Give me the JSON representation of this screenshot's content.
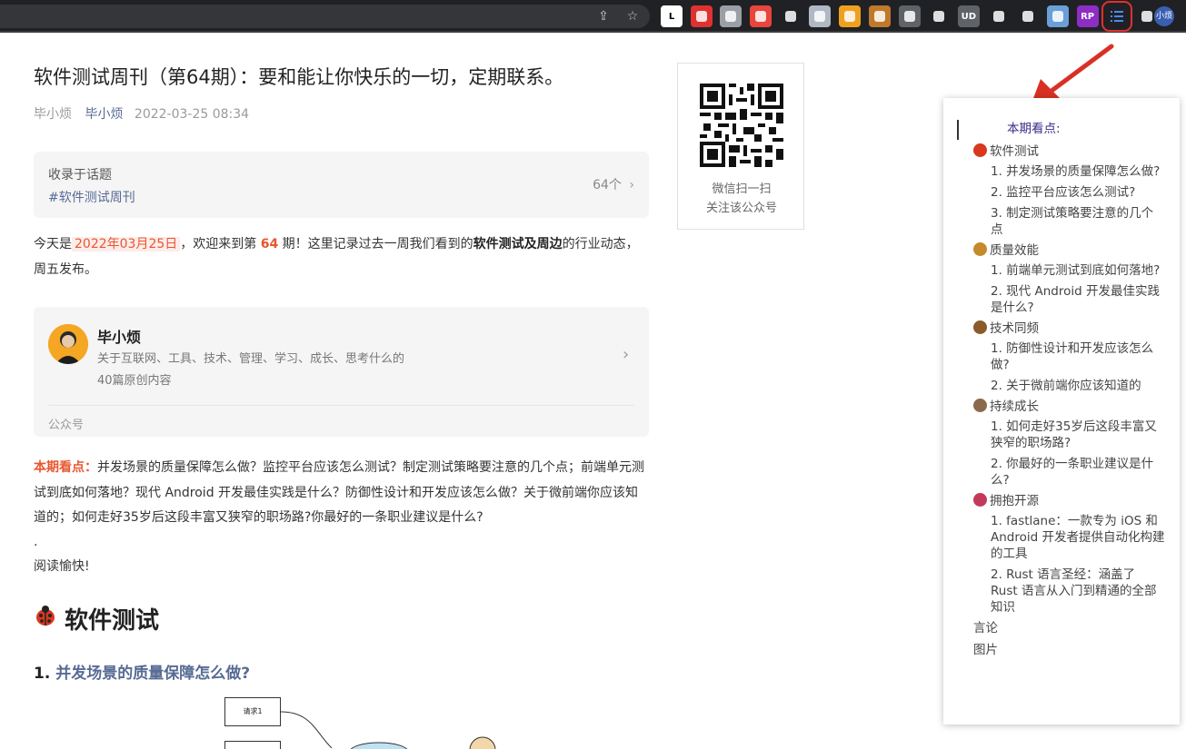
{
  "browser": {
    "extensions": [
      {
        "name": "ext-l",
        "label": "L",
        "color": "#ffffff",
        "text": "#000000"
      },
      {
        "name": "ext-red-doc",
        "label": "",
        "color": "#e03131",
        "text": "#ffffff"
      },
      {
        "name": "ext-circle",
        "label": "",
        "color": "#9aa0a6",
        "text": "#ffffff"
      },
      {
        "name": "ext-notes",
        "label": "",
        "color": "#e8453c",
        "text": "#ffffff"
      },
      {
        "name": "ext-shield",
        "label": "",
        "color": "#202124",
        "text": "#ffffff"
      },
      {
        "name": "ext-upload",
        "label": "",
        "color": "#b0b8c4",
        "text": "#ffffff"
      },
      {
        "name": "ext-globe",
        "label": "",
        "color": "#f0a020",
        "text": "#ffffff"
      },
      {
        "name": "ext-owl",
        "label": "",
        "color": "#c0782a",
        "text": "#ffffff"
      },
      {
        "name": "ext-speed",
        "label": "",
        "color": "#5f6368",
        "text": "#ffffff"
      },
      {
        "name": "ext-diamond",
        "label": "",
        "color": "#202124",
        "text": "#ffffff"
      },
      {
        "name": "ext-ublock",
        "label": "UD",
        "color": "#5f6368",
        "text": "#ffffff"
      },
      {
        "name": "ext-block",
        "label": "",
        "color": "#202124",
        "text": "#ffffff"
      },
      {
        "name": "ext-glasses",
        "label": "",
        "color": "#202124",
        "text": "#ffffff"
      },
      {
        "name": "ext-photo",
        "label": "",
        "color": "#6a9fd8",
        "text": "#ffffff"
      },
      {
        "name": "ext-rp",
        "label": "RP",
        "color": "#8e2dc5",
        "text": "#ffffff"
      },
      {
        "name": "ext-toc",
        "label": "",
        "color": "#202124",
        "text": "#4a8af4",
        "selected": true
      },
      {
        "name": "ext-puzzle",
        "label": "",
        "color": "#202124",
        "text": "#ffffff"
      }
    ],
    "profile_label": "小烦"
  },
  "article": {
    "title": "软件测试周刊（第64期）：要和能让你快乐的一切，定期联系。",
    "author_plain": "毕小烦",
    "author_link": "毕小烦",
    "date": "2022-03-25 08:34",
    "topic_label": "收录于话题",
    "topic_tag": "#软件测试周刊",
    "topic_count": "64个",
    "intro": {
      "p1": "今天是",
      "date_hl": "2022年03月25日",
      "p2": "，欢迎来到第",
      "num": "64",
      "p3": "期！这里记录过去一周我们看到的",
      "bold": "软件测试及周边",
      "p4": "的行业动态，周五发布。"
    },
    "card": {
      "name": "毕小烦",
      "desc": "关于互联网、工具、技术、管理、学习、成长、思考什么的",
      "count": "40篇原创内容",
      "type": "公众号"
    },
    "highlights_label": "本期看点：",
    "highlights_text": "并发场景的质量保障怎么做？监控平台应该怎么测试？制定测试策略要注意的几个点；前端单元测试到底如何落地？现代 Android 开发最佳实践是什么？防御性设计和开发应该怎么做？关于微前端你应该知道的；如何走好35岁后这段丰富又狭窄的职场路?你最好的一条职业建议是什么?",
    "dot": ".",
    "enjoy": "阅读愉快!",
    "h2": "软件测试",
    "h3_num": "1.",
    "h3_link": "并发场景的质量保障怎么做?",
    "diagram_box": "请求1"
  },
  "qr": {
    "line1": "微信扫一扫",
    "line2": "关注该公众号"
  },
  "toc": {
    "head": "本期看点:",
    "sections": [
      {
        "title": "软件测试",
        "emoji_color": "#d9381e",
        "items": [
          "1. 并发场景的质量保障怎么做?",
          "2. 监控平台应该怎么测试?",
          "3. 制定测试策略要注意的几个点"
        ]
      },
      {
        "title": "质量效能",
        "emoji_color": "#c58a2a",
        "items": [
          "1. 前端单元测试到底如何落地?",
          "2. 现代 Android 开发最佳实践是什么?"
        ]
      },
      {
        "title": "技术同频",
        "emoji_color": "#8a5a2a",
        "items": [
          "1. 防御性设计和开发应该怎么做?",
          "2. 关于微前端你应该知道的"
        ]
      },
      {
        "title": "持续成长",
        "emoji_color": "#8a6a4a",
        "items": [
          "1. 如何走好35岁后这段丰富又狭窄的职场路?",
          "2. 你最好的一条职业建议是什么?"
        ]
      },
      {
        "title": "拥抱开源",
        "emoji_color": "#c23a5a",
        "items": [
          "1. fastlane：一款专为 iOS 和 Android 开发者提供自动化构建的工具",
          "2. Rust 语言圣经：涵盖了 Rust 语言从入门到精通的全部知识"
        ]
      }
    ],
    "tail": [
      "言论",
      "图片"
    ]
  }
}
